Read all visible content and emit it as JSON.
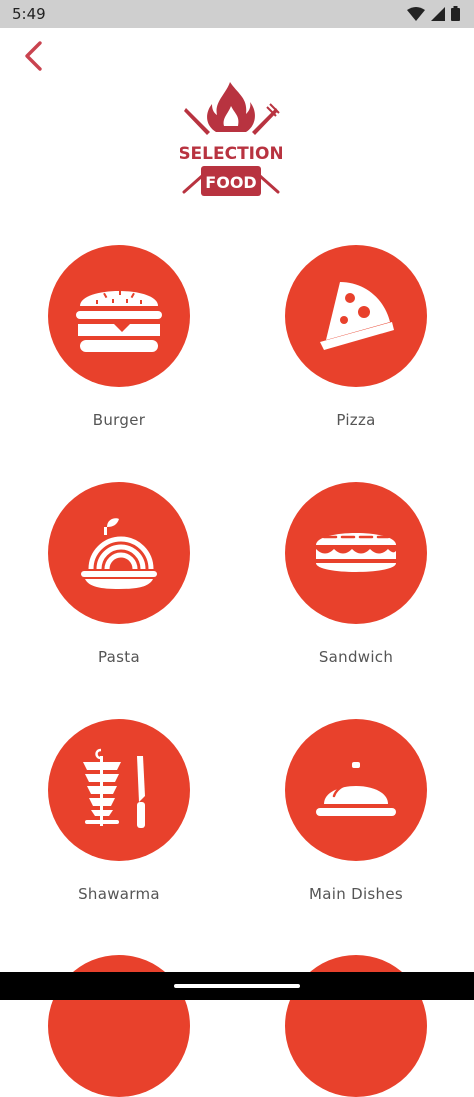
{
  "status": {
    "time": "5:49"
  },
  "logo": {
    "line1": "SELECTION",
    "line2": "FOOD"
  },
  "categories": [
    {
      "label": "Burger",
      "icon": "burger-icon"
    },
    {
      "label": "Pizza",
      "icon": "pizza-icon"
    },
    {
      "label": "Pasta",
      "icon": "pasta-icon"
    },
    {
      "label": "Sandwich",
      "icon": "sandwich-icon"
    },
    {
      "label": "Shawarma",
      "icon": "shawarma-icon"
    },
    {
      "label": "Main Dishes",
      "icon": "cloche-icon"
    }
  ],
  "colors": {
    "accent": "#e8412c",
    "brand": "#b83340",
    "text": "#555555"
  }
}
